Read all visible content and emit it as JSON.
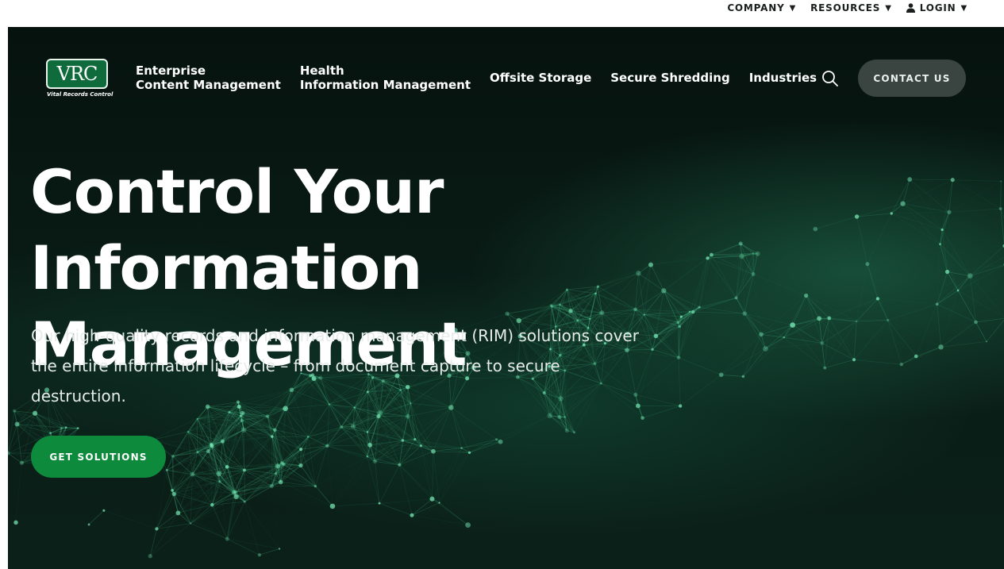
{
  "topnav": {
    "company": "COMPANY",
    "resources": "RESOURCES",
    "login": "LOGIN"
  },
  "logo": {
    "mark": "VRC",
    "tagline": "Vital Records Control"
  },
  "mainnav": {
    "items": [
      {
        "line1": "Enterprise",
        "line2": "Content Management"
      },
      {
        "line1": "Health",
        "line2": "Information Management"
      },
      {
        "line1": "Offsite Storage",
        "line2": ""
      },
      {
        "line1": "Secure Shredding",
        "line2": ""
      },
      {
        "line1": "Industries",
        "line2": ""
      }
    ],
    "contact_label": "CONTACT US"
  },
  "hero": {
    "title_line1": "Control Your Information",
    "title_line2": "Management",
    "description": "Our high-quality records and information management (RIM) solutions cover the entire information lifecycle – from document capture to secure destruction.",
    "cta_label": "GET SOLUTIONS"
  },
  "colors": {
    "brand_green": "#0e8a3c",
    "hero_bg": "#06120e",
    "contact_bg": "#3a4542",
    "logo_green": "#0f6b3b"
  },
  "icons": {
    "search": "search-icon",
    "user": "user-icon",
    "caret": "caret-down-icon"
  }
}
